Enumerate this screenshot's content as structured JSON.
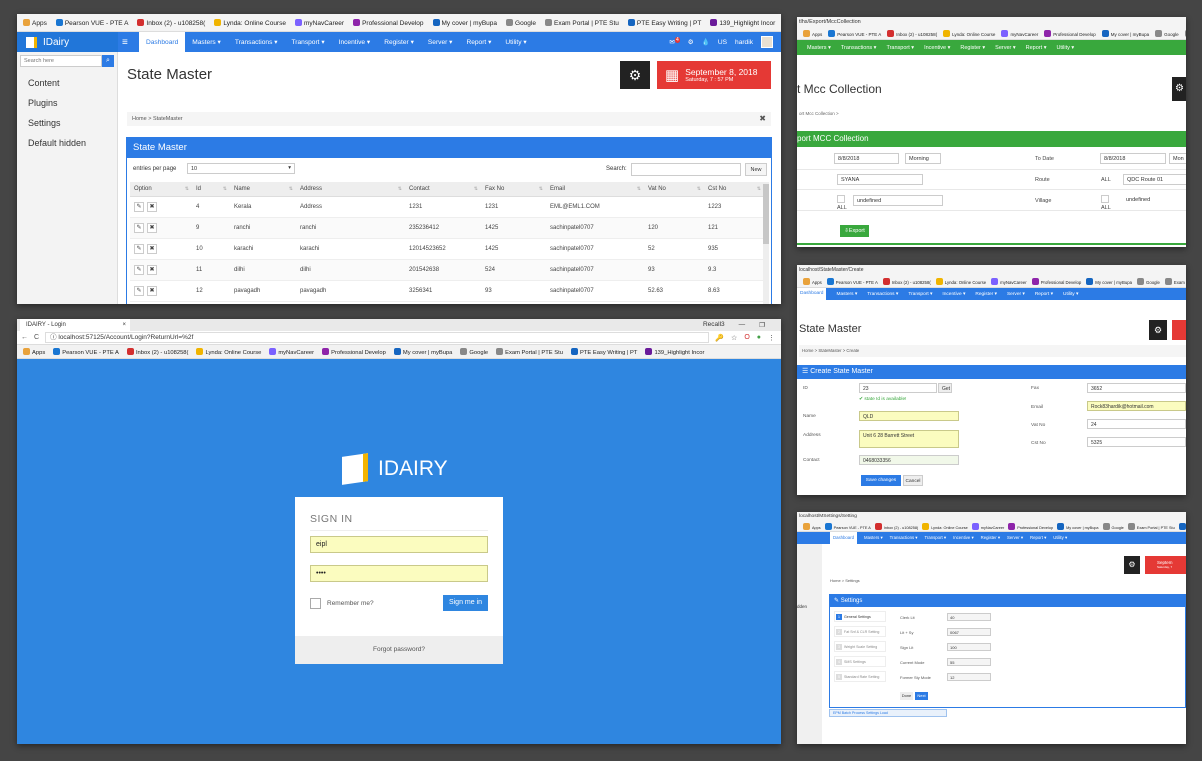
{
  "bookmarks": [
    "Apps",
    "Pearson VUE - PTE A",
    "Inbox (2) - u108258(",
    "Lynda: Online Course",
    "myNavCareer",
    "Professional Develop",
    "My cover | myBupa",
    "Google",
    "Exam Portal | PTE Stu",
    "PTE Easy Writing | PT",
    "139_Highlight Incor"
  ],
  "bookmarks_more": "»",
  "colors": {
    "primary": "#2c7be5",
    "green": "#39a83d",
    "danger": "#e53935",
    "login_bg": "#2f86e0"
  },
  "state_master": {
    "brand": "IDairy",
    "nav": [
      "Dashboard",
      "Masters ▾",
      "Transactions ▾",
      "Transport ▾",
      "Incentive ▾",
      "Register ▾",
      "Server ▾",
      "Report ▾",
      "Utility ▾"
    ],
    "nav_right": {
      "badge": "4",
      "lang": "US",
      "user": "hardik"
    },
    "search_placeholder": "Search here",
    "sidebar": [
      "Content",
      "Plugins",
      "Settings",
      "Default hidden"
    ],
    "title": "State Master",
    "date_main": "September 8, 2018",
    "date_sub": "Saturday, 7 : 57 PM",
    "breadcrumb": "Home > StateMaster",
    "box_title": "State Master",
    "entries_label": "entries per page",
    "entries_value": "10",
    "search_label": "Search:",
    "new_label": "New",
    "columns": [
      "Option",
      "Id",
      "Name",
      "Address",
      "Contact",
      "Fax No",
      "Email",
      "Vat No",
      "Cst No"
    ],
    "rows": [
      [
        "4",
        "Kerala",
        "Address",
        "1231",
        "1231",
        "EML@EML1.COM",
        "",
        "1223"
      ],
      [
        "9",
        "ranchi",
        "ranchi",
        "235236412",
        "1425",
        "sachinpatel0707",
        "120",
        "121"
      ],
      [
        "10",
        "karachi",
        "karachi",
        "12014523652",
        "1425",
        "sachinpatel0707",
        "52",
        "935"
      ],
      [
        "11",
        "dilhi",
        "dilhi",
        "201542638",
        "524",
        "sachinpatel0707",
        "93",
        "9.3"
      ],
      [
        "12",
        "pavagadh",
        "pavagadh",
        "3256341",
        "93",
        "sachinpatel0707",
        "52.63",
        "8.63"
      ]
    ]
  },
  "mcc": {
    "url": "tlhs/Export/MccCollection",
    "nav": [
      "Masters ▾",
      "Transactions ▾",
      "Transport ▾",
      "Incentive ▾",
      "Register ▾",
      "Server ▾",
      "Report ▾",
      "Utility ▾"
    ],
    "title": "rt Mcc Collection",
    "breadcrumb": "ort Mcc Collection >",
    "box_title": "port MCC Collection",
    "from_date": "8/8/2018",
    "from_shift": "Morning",
    "to_label": "To Date",
    "to_date": "8/8/2018",
    "to_shift": "Mon",
    "union": "SYANA",
    "route_label": "Route",
    "route_all": "ALL",
    "route_value": "QDC Route 01",
    "all_label": "ALL",
    "undefined_1": "undefined",
    "village_label": "Village",
    "undefined_2": "undefined",
    "export_label": "Export"
  },
  "login": {
    "tab_title": "IDAIRY - Login",
    "tab_close": "×",
    "window_user": "Recall3",
    "url": "localhost:57125/Account/Login?ReturnUrl=%2f",
    "brand": "IDAIRY",
    "heading": "SIGN IN",
    "username": "eipl",
    "password": "••••",
    "remember": "Remember me?",
    "signin": "Sign me in",
    "forgot": "Forgot password?"
  },
  "create_state": {
    "url": "localhost/StateMaster/Create",
    "nav_active": "Dashboard",
    "nav": [
      "Masters ▾",
      "Transactions ▾",
      "Transport ▾",
      "Incentive ▾",
      "Register ▾",
      "Server ▾",
      "Report ▾",
      "Utility ▾"
    ],
    "title": "State Master",
    "breadcrumb": "Home > StateMaster > Create",
    "box_title": "Create State Master",
    "id_label": "ID",
    "id_value": "23",
    "get_label": "Get",
    "id_available": "✔ state Id is available!",
    "name_label": "Name",
    "name_value": "QLD",
    "address_label": "Address",
    "address_value": "Unit 6 28 Barrett Street",
    "contact_label": "Contact",
    "contact_value": "0468033356",
    "fax_label": "Fax",
    "fax_value": "3652",
    "email_label": "Email",
    "email_value": "Rock83hardik@hotmail.com",
    "vat_label": "Vat No",
    "vat_value": "24",
    "cst_label": "Cst No",
    "cst_value": "5325",
    "save": "Save changes",
    "cancel": "Cancel"
  },
  "settings": {
    "url": "localhost/MSettings/Setting",
    "nav_active": "Dashboard",
    "nav": [
      "Masters ▾",
      "Transactions ▾",
      "Transport ▾",
      "Incentive ▾",
      "Register ▾",
      "Server ▾",
      "Report ▾",
      "Utility ▾"
    ],
    "sidebar_text": "dden",
    "date_text": "Septem",
    "date_sub": "Saturday, 7",
    "breadcrumb": "Home > Settings",
    "box_title": "Settings",
    "steps": [
      "General Settings",
      "Fat Snf & CLR Setting",
      "Weight Scale Setting",
      "SMS Settings",
      "Standard Rate Setting"
    ],
    "fields": [
      {
        "label": "Clerk Lit",
        "value": "40"
      },
      {
        "label": "Lit + Sy",
        "value": "0067"
      },
      {
        "label": "Sign Lit",
        "value": "100"
      },
      {
        "label": "Current Mode",
        "value": "55"
      },
      {
        "label": "Former Sty Mode",
        "value": "12"
      }
    ],
    "btn_done": "Done",
    "btn_next": "Next",
    "footer": "EPM Batch Process Settings Load"
  }
}
